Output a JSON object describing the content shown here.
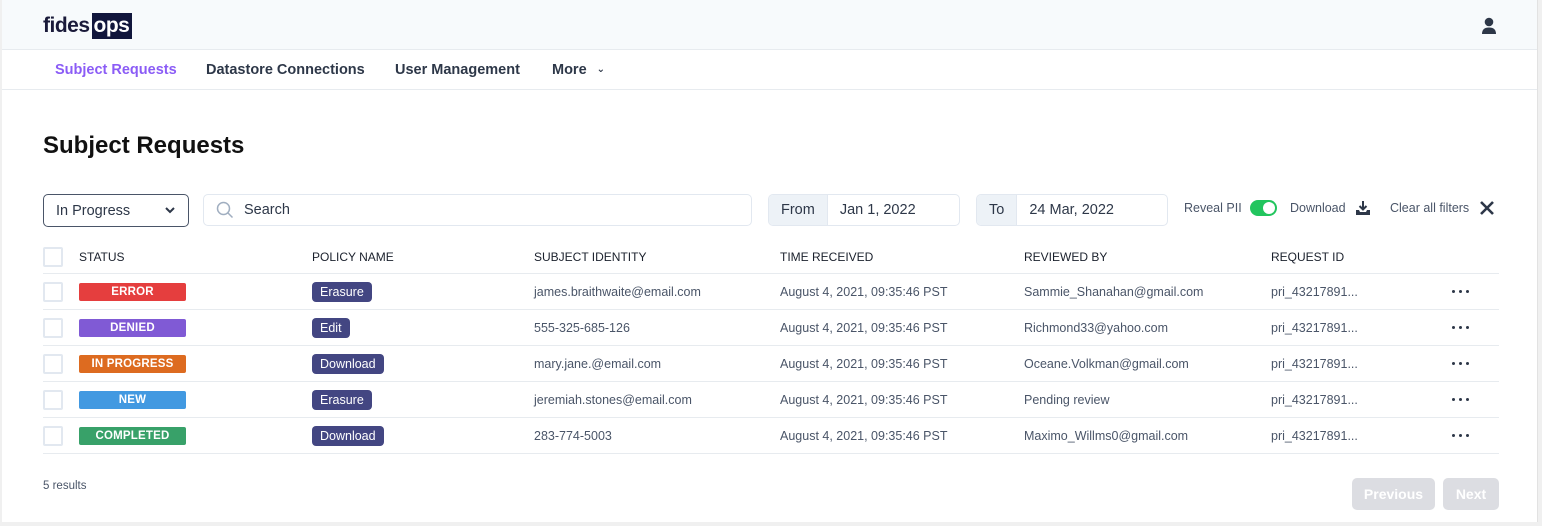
{
  "app": {
    "logo_left": "fides",
    "logo_right": "ops"
  },
  "nav": {
    "items": [
      {
        "label": "Subject Requests",
        "active": true
      },
      {
        "label": "Datastore Connections",
        "active": false
      },
      {
        "label": "User Management",
        "active": false
      },
      {
        "label": "More",
        "active": false,
        "has_dropdown": true
      }
    ]
  },
  "page": {
    "title": "Subject Requests"
  },
  "filters": {
    "status_selected": "In Progress",
    "search_placeholder": "Search",
    "from_label": "From",
    "from_value": "Jan 1, 2022",
    "to_label": "To",
    "to_value": "24 Mar, 2022",
    "reveal_pii_label": "Reveal PII",
    "reveal_pii_on": true,
    "download_label": "Download",
    "clear_label": "Clear all filters"
  },
  "table": {
    "columns": [
      "STATUS",
      "POLICY NAME",
      "SUBJECT IDENTITY",
      "TIME RECEIVED",
      "REVIEWED BY",
      "REQUEST ID"
    ],
    "rows": [
      {
        "status": "ERROR",
        "status_color": "#e53e3e",
        "policy": "Erasure",
        "identity": "james.braithwaite@email.com",
        "time": "August 4, 2021, 09:35:46 PST",
        "reviewer": "Sammie_Shanahan@gmail.com",
        "request_id": "pri_43217891..."
      },
      {
        "status": "DENIED",
        "status_color": "#805ad5",
        "policy": "Edit",
        "identity": "555-325-685-126",
        "time": "August 4, 2021, 09:35:46 PST",
        "reviewer": "Richmond33@yahoo.com",
        "request_id": "pri_43217891..."
      },
      {
        "status": "IN PROGRESS",
        "status_color": "#dd6b20",
        "policy": "Download",
        "identity": "mary.jane.@email.com",
        "time": "August 4, 2021, 09:35:46 PST",
        "reviewer": "Oceane.Volkman@gmail.com",
        "request_id": "pri_43217891..."
      },
      {
        "status": "NEW",
        "status_color": "#4299e1",
        "policy": "Erasure",
        "identity": "jeremiah.stones@email.com",
        "time": "August 4, 2021, 09:35:46 PST",
        "reviewer": "Pending review",
        "request_id": "pri_43217891..."
      },
      {
        "status": "COMPLETED",
        "status_color": "#38a169",
        "policy": "Download",
        "identity": "283-774-5003",
        "time": "August 4, 2021, 09:35:46 PST",
        "reviewer": "Maximo_Willms0@gmail.com",
        "request_id": "pri_43217891..."
      }
    ]
  },
  "footer": {
    "results": "5 results",
    "previous": "Previous",
    "next": "Next"
  }
}
